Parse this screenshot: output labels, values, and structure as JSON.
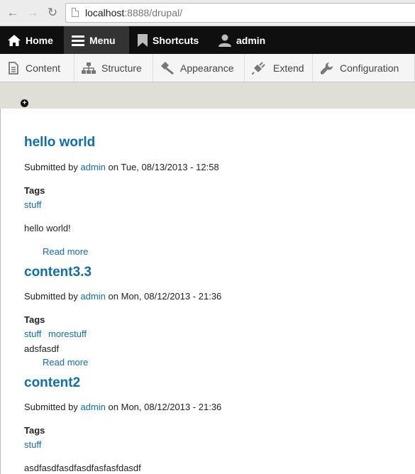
{
  "browser": {
    "url_host": "localhost",
    "url_rest": ":8888/drupal/"
  },
  "toolbar": {
    "home": "Home",
    "menu": "Menu",
    "shortcuts": "Shortcuts",
    "user": "admin"
  },
  "tray": {
    "items": [
      "Content",
      "Structure",
      "Appearance",
      "Extend",
      "Configuration"
    ]
  },
  "nodes": [
    {
      "title": "hello world",
      "submitted_prefix": "Submitted by",
      "author": "admin",
      "date": "on Tue, 08/13/2013 - 12:58",
      "tags_label": "Tags",
      "tags": [
        "stuff"
      ],
      "body": "hello world!",
      "read_more": "Read more"
    },
    {
      "title": "content3.3",
      "submitted_prefix": "Submitted by",
      "author": "admin",
      "date": "on Mon, 08/12/2013 - 21:36",
      "tags_label": "Tags",
      "tags": [
        "stuff",
        "morestuff"
      ],
      "body": "adsfasdf",
      "read_more": "Read more"
    },
    {
      "title": "content2",
      "submitted_prefix": "Submitted by",
      "author": "admin",
      "date": "on Mon, 08/12/2013 - 21:36",
      "tags_label": "Tags",
      "tags": [
        "stuff"
      ],
      "body": "asdfasdfasdfasdfasfasfdasdf"
    }
  ]
}
